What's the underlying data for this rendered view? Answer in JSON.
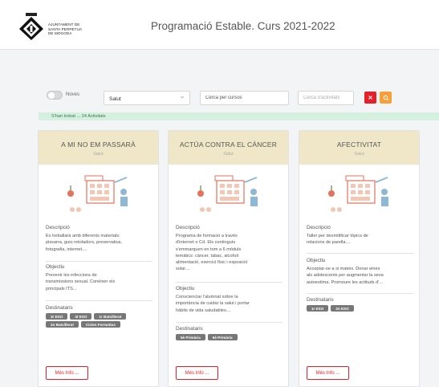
{
  "header": {
    "logo_lines": [
      "AJUNTAMENT DE",
      "SANTA PERPÈTUA",
      "DE MOGODA"
    ],
    "title": "Programació Estable. Curs 2021-2022"
  },
  "filters": {
    "toggle_label": "Noves",
    "category_value": "Salut",
    "course_placeholder": "Cerca per cursos",
    "activity_placeholder": "Cerca d'activitats",
    "clear_icon": "x-icon",
    "search_icon": "search-icon"
  },
  "result_text": "S'han trobat ... 24 Activitats",
  "labels": {
    "description": "Descripció",
    "objective": "Objectiu",
    "audience": "Destinataris",
    "more": "Més Info ..."
  },
  "cards": [
    {
      "title": "A MI NO EM PASSARÀ",
      "category": "Salut",
      "description": [
        "Es treballarà amb diferents materials:",
        "pissarra, guio retoladors, preservatius,",
        "fotografia, internet...."
      ],
      "objective": [
        "Prevenir les infeccions de",
        "transmissions sexual. Conèixer els",
        "principals ITS..."
      ],
      "audience": [
        "3r ESO",
        "4t ESO",
        "1r Batxillerat",
        "2n Batxillerat",
        "Cicles Formatius"
      ]
    },
    {
      "title": "ACTÚA CONTRA EL CÀNCER",
      "category": "Salut",
      "description": [
        "Programa de formació a través",
        "d'internet o Cd. Els continguts",
        "s'emmarquen en tom a 6 mòduls",
        "temàtics: càncer, tabac, alcohol",
        "alimentació, exercici físic i exposició",
        "solar...."
      ],
      "objective": [
        "Conscienciar l'alumnat sobre la",
        "importància de cuidar la salut i portar",
        "hàbits de vida saludables...."
      ],
      "audience": [
        "5è Primària",
        "6è Primària"
      ]
    },
    {
      "title": "AFECTIVITAT",
      "category": "Salut",
      "description": [
        "Taller per desmitificar tòpics de",
        "relacions de parella...."
      ],
      "objective": [
        "Acceptar-se a si mateix. Donar eines",
        "als adolescents per augmentar la seva",
        "autoestima. Promoure les actituds d'..."
      ],
      "audience": [
        "1r ESO",
        "2n ESO"
      ]
    }
  ],
  "colors": {
    "accent_red": "#e4202b",
    "accent_orange": "#f7a03a",
    "card_header": "#f0e7c8",
    "result_bar": "#d6f0e0"
  }
}
